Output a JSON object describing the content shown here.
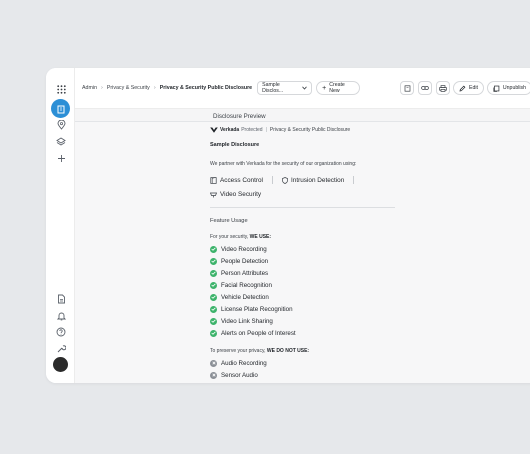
{
  "breadcrumb": {
    "root": "Admin",
    "section": "Privacy & Security",
    "current": "Privacy & Security Public Disclosure"
  },
  "toolbar": {
    "select_value": "Sample Disclos...",
    "create_label": "Create New",
    "edit_label": "Edit",
    "unpublish_label": "Unpublish"
  },
  "preview": {
    "header": "Disclosure Preview",
    "brand": "Verkada",
    "protected": "Protected",
    "public_title": "Privacy & Security Public Disclosure",
    "doc_title": "Sample Disclosure",
    "partner_text": "We partner with Verkada for the security of our organization using:",
    "products": [
      "Access Control",
      "Intrusion Detection",
      "Video Security"
    ],
    "feature_usage": "Feature Usage",
    "use_prefix": "For your security,",
    "use_bold": "WE USE:",
    "used_features": [
      "Video Recording",
      "People Detection",
      "Person Attributes",
      "Facial Recognition",
      "Vehicle Detection",
      "License Plate Recognition",
      "Video Link Sharing",
      "Alerts on People of Interest"
    ],
    "notuse_prefix": "To preserve your privacy,",
    "notuse_bold": "WE DO NOT USE:",
    "unused_features": [
      "Audio Recording",
      "Sensor Audio"
    ]
  },
  "colors": {
    "accent": "#2c8fd6",
    "check": "#3db36b",
    "disabled": "#8a8f96"
  }
}
